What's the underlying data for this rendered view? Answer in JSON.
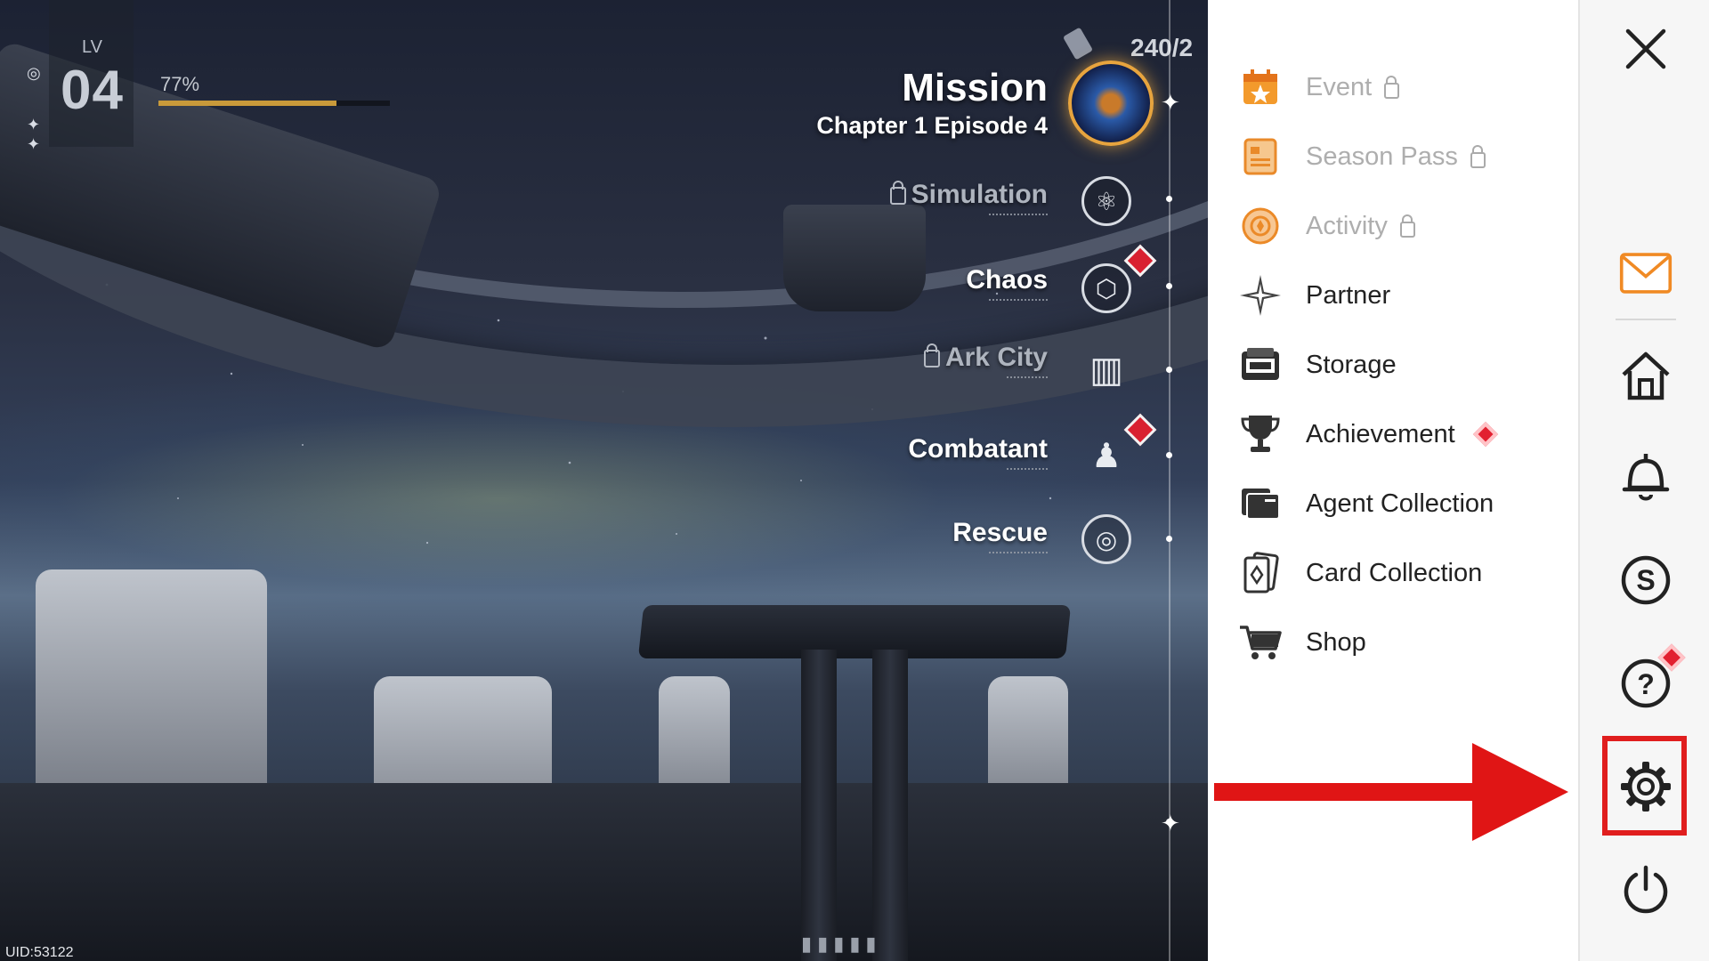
{
  "hud": {
    "level_label": "LV",
    "level": "04",
    "xp_percent": "77%",
    "xp_fraction": 0.77,
    "stamina": "240/2",
    "uid": "UID:53122"
  },
  "missions": {
    "main_title": "Mission",
    "main_subtitle": "Chapter 1 Episode 4",
    "modes": [
      {
        "label": "Simulation",
        "locked": true,
        "badge": false,
        "icon": "atom-icon"
      },
      {
        "label": "Chaos",
        "locked": false,
        "badge": true,
        "icon": "geodesic-icon"
      },
      {
        "label": "Ark City",
        "locked": true,
        "badge": false,
        "icon": "city-icon"
      },
      {
        "label": "Combatant",
        "locked": false,
        "badge": true,
        "icon": "squad-icon"
      },
      {
        "label": "Rescue",
        "locked": false,
        "badge": false,
        "icon": "target-icon"
      }
    ]
  },
  "menu": {
    "items": [
      {
        "label": "Event",
        "locked": true,
        "icon": "calendar-star-icon"
      },
      {
        "label": "Season Pass",
        "locked": true,
        "icon": "pass-card-icon"
      },
      {
        "label": "Activity",
        "locked": true,
        "icon": "activity-badge-icon"
      },
      {
        "label": "Partner",
        "locked": false,
        "icon": "sparkle-icon"
      },
      {
        "label": "Storage",
        "locked": false,
        "icon": "storage-box-icon"
      },
      {
        "label": "Achievement",
        "locked": false,
        "badge": true,
        "icon": "trophy-icon"
      },
      {
        "label": "Agent Collection",
        "locked": false,
        "icon": "folder-stack-icon"
      },
      {
        "label": "Card Collection",
        "locked": false,
        "icon": "cards-icon"
      },
      {
        "label": "Shop",
        "locked": false,
        "icon": "cart-icon"
      }
    ]
  },
  "sidebar": {
    "buttons": [
      "close-icon",
      "mail-icon",
      "home-icon",
      "bell-icon",
      "currency-s-icon",
      "help-icon",
      "gear-icon",
      "power-icon"
    ],
    "highlighted": "gear-icon"
  },
  "colors": {
    "accent_orange": "#f08a24",
    "highlight_red": "#e01e1e",
    "badge_red": "#e22030"
  }
}
